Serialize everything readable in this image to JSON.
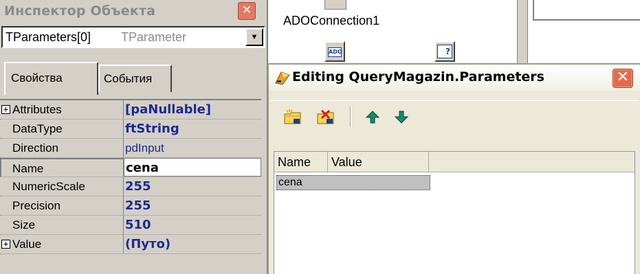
{
  "inspector": {
    "title": "Инспектор Объекта",
    "selected_object": "TParameters[0]",
    "selected_type": "TParameter",
    "tabs": [
      {
        "label": "Свойства",
        "active": true
      },
      {
        "label": "События",
        "active": false
      }
    ],
    "properties": [
      {
        "name": "Attributes",
        "value": "[paNullable]",
        "expandable": true
      },
      {
        "name": "DataType",
        "value": "ftString",
        "expandable": false
      },
      {
        "name": "Direction",
        "value": "pdInput",
        "expandable": false
      },
      {
        "name": "Name",
        "value": "cena",
        "expandable": false,
        "selected": true
      },
      {
        "name": "NumericScale",
        "value": "255",
        "expandable": false
      },
      {
        "name": "Precision",
        "value": "255",
        "expandable": false
      },
      {
        "name": "Size",
        "value": "510",
        "expandable": false
      },
      {
        "name": "Value",
        "value": "(Путо)",
        "expandable": true
      }
    ]
  },
  "designer": {
    "connection_label": "ADOConnection1",
    "ado_icon_text": "ADO",
    "query_icon_text": "?"
  },
  "dialog": {
    "title": "Editing QueryMagazin.Parameters",
    "toolbar": [
      "add-icon",
      "delete-icon",
      "move-up-icon",
      "move-down-icon"
    ],
    "columns": [
      "Name",
      "Value"
    ],
    "rows": [
      {
        "name": "cena",
        "value": ""
      }
    ]
  },
  "colors": {
    "value_text": "#1c2a8f",
    "close_button": "#e36b4d",
    "dialog_bg": "#ece9d8",
    "panel_bg": "#d4d0c8"
  }
}
